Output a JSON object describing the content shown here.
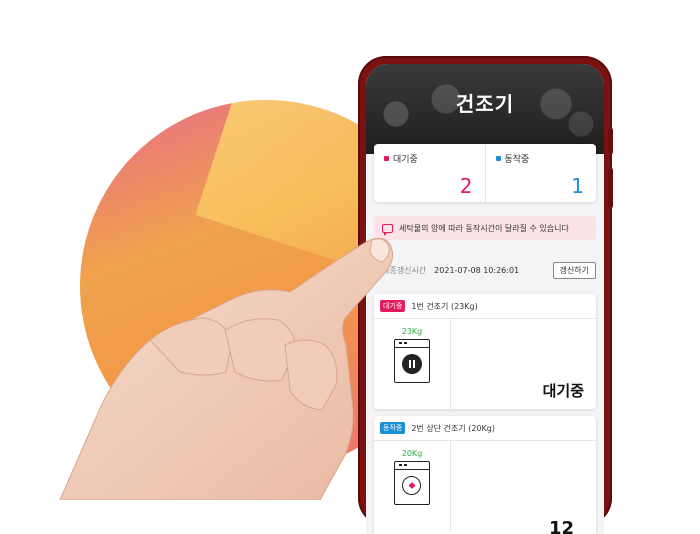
{
  "screen": {
    "title": "건조기"
  },
  "status": {
    "waiting": {
      "label": "대기중",
      "count": "2",
      "color": "#e4195f"
    },
    "running": {
      "label": "동작중",
      "count": "1",
      "color": "#1b8ed8"
    }
  },
  "notice": {
    "text": "세탁물의 양에 따라 동작시간이 달라질 수 있습니다",
    "icon": "speech-bubble-icon"
  },
  "update": {
    "label": "최종갱신시간",
    "time": "2021-07-08 10:26:01",
    "button_label": "갱신하기"
  },
  "machines": [
    {
      "badge": "대기중",
      "badge_color": "#e4195f",
      "name": "1번 건조기 (23Kg)",
      "capacity": "23Kg",
      "icon": "dryer-pause-icon",
      "status_text": "대기중"
    },
    {
      "badge": "동작중",
      "badge_color": "#1b8ed8",
      "name": "2번 상단 건조기 (20Kg)",
      "capacity": "20Kg",
      "icon": "dryer-fan-icon",
      "status_text": "12"
    }
  ],
  "colors": {
    "accent_pink": "#e4195f",
    "accent_blue": "#1b8ed8",
    "capacity_green": "#2eaf3a",
    "phone_frame": "#7c1111"
  }
}
